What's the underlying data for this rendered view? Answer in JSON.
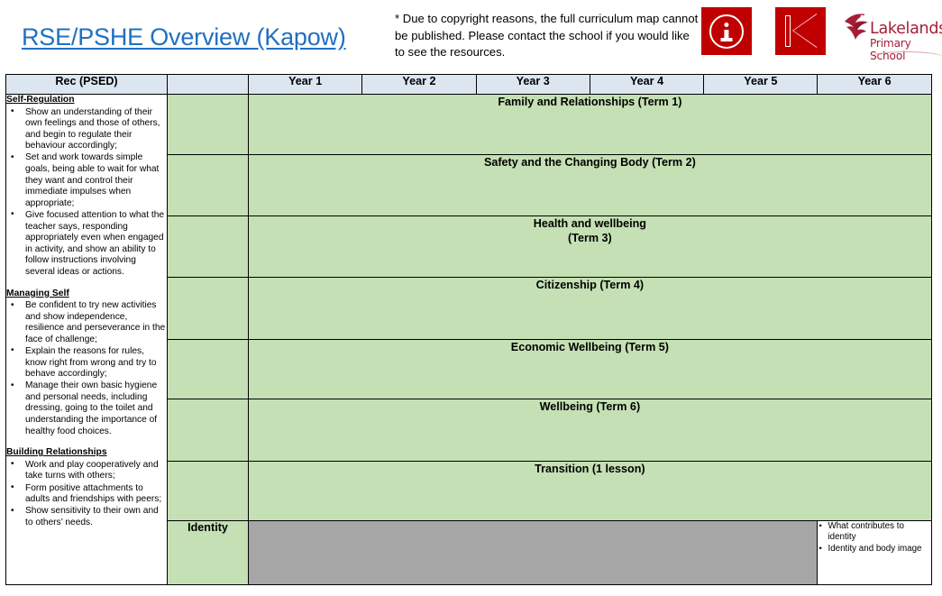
{
  "header": {
    "title": "RSE/PSHE Overview (Kapow)",
    "copyright_note": "* Due to copyright reasons, the full curriculum map cannot be published. Please contact the school if you would like to see the resources.",
    "logos": [
      {
        "icon": "info-icon",
        "background": "#c00000"
      },
      {
        "icon": "skip-back-icon",
        "background": "#c00000"
      }
    ],
    "school_logo": {
      "icon": "swan-bird-icon",
      "name_line1": "Lakelands",
      "name_line2": "Primary School",
      "color": "#a51e36"
    }
  },
  "colors": {
    "title": "#2170c0",
    "header_row": "#dce6f1",
    "topic_cell": "#c5e0b4",
    "blocked_cell": "#a6a6a6",
    "logo_red": "#c00000",
    "school_red": "#a51e36"
  },
  "table": {
    "columns": [
      "Rec (PSED)",
      "",
      "Year 1",
      "Year 2",
      "Year 3",
      "Year 4",
      "Year 5",
      "Year 6"
    ],
    "rec_descriptors": [
      {
        "heading": "Self-Regulation",
        "items": [
          "Show an understanding of their own feelings and those of others, and begin to regulate their behaviour accordingly;",
          "Set and work towards simple goals, being able to wait for what they want and control their immediate impulses when appropriate;",
          "Give focused attention to what the teacher says, responding appropriately even when engaged in activity, and show an ability to follow instructions involving several ideas or actions."
        ]
      },
      {
        "heading": "Managing Self",
        "items": [
          "Be confident to try new activities and show independence, resilience and perseverance in the face of challenge;",
          "Explain the reasons for rules, know right from wrong and try to behave accordingly;",
          "Manage their own basic hygiene and personal needs, including dressing, going to the toilet and understanding the importance of healthy food choices."
        ]
      },
      {
        "heading": "Building Relationships",
        "items": [
          "Work and play cooperatively and take turns with others;",
          "Form positive attachments to adults and friendships with peers;",
          "Show sensitivity to their own and to others’ needs."
        ]
      }
    ],
    "topic_rows": [
      {
        "label": "Family and Relationships (Term 1)",
        "label_line2": ""
      },
      {
        "label": "Safety and the Changing Body (Term 2)",
        "label_line2": ""
      },
      {
        "label": "Health and wellbeing",
        "label_line2": "(Term 3)"
      },
      {
        "label": "Citizenship  (Term 4)",
        "label_line2": ""
      },
      {
        "label": "Economic Wellbeing (Term 5)",
        "label_line2": ""
      },
      {
        "label": "Wellbeing (Term 6)",
        "label_line2": ""
      },
      {
        "label": "Transition (1 lesson)",
        "label_line2": ""
      }
    ],
    "identity_row": {
      "label": "Identity",
      "blocked_years": [
        "Year 1",
        "Year 2",
        "Year 3",
        "Year 4",
        "Year 5"
      ],
      "year6_items": [
        "What contributes to identity",
        "Identity and body image"
      ]
    }
  }
}
